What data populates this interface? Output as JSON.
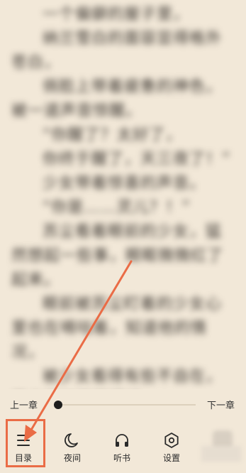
{
  "reader": {
    "paragraphs": [
      "一个偏僻的屋子里，",
      "纳兰雪白的面容显得格外苍白，",
      "俏脸上带着疲惫的神色，被一道声音惊醒。",
      "“你醒了？太好了，",
      "你终于醒了，天三夜了！”",
      "少女带着惊喜的声音。",
      "“你是……灵儿？！”",
      "苏尘看着眼前的少女，猛然想起一些事，眼眶微微红了起来。",
      "眼前被苏尘盯着的少女心里也在嘀咕着，知道他的情况，",
      "被少女看得有些不自在，苏尘连忙移开视线。"
    ]
  },
  "progress": {
    "prev_label": "上一章",
    "next_label": "下一章",
    "value_fraction": 0.0
  },
  "toolbar": {
    "catalog": {
      "label": "目录",
      "icon": "menu-icon"
    },
    "night": {
      "label": "夜间",
      "icon": "moon-icon"
    },
    "listen": {
      "label": "听书",
      "icon": "headphones-icon"
    },
    "settings": {
      "label": "设置",
      "icon": "settings-icon"
    }
  },
  "colors": {
    "background": "#f2e8d8",
    "annotation": "#ea6c46",
    "slider_track": "#ddd0bc",
    "slider_knob": "#1e1e1e"
  }
}
